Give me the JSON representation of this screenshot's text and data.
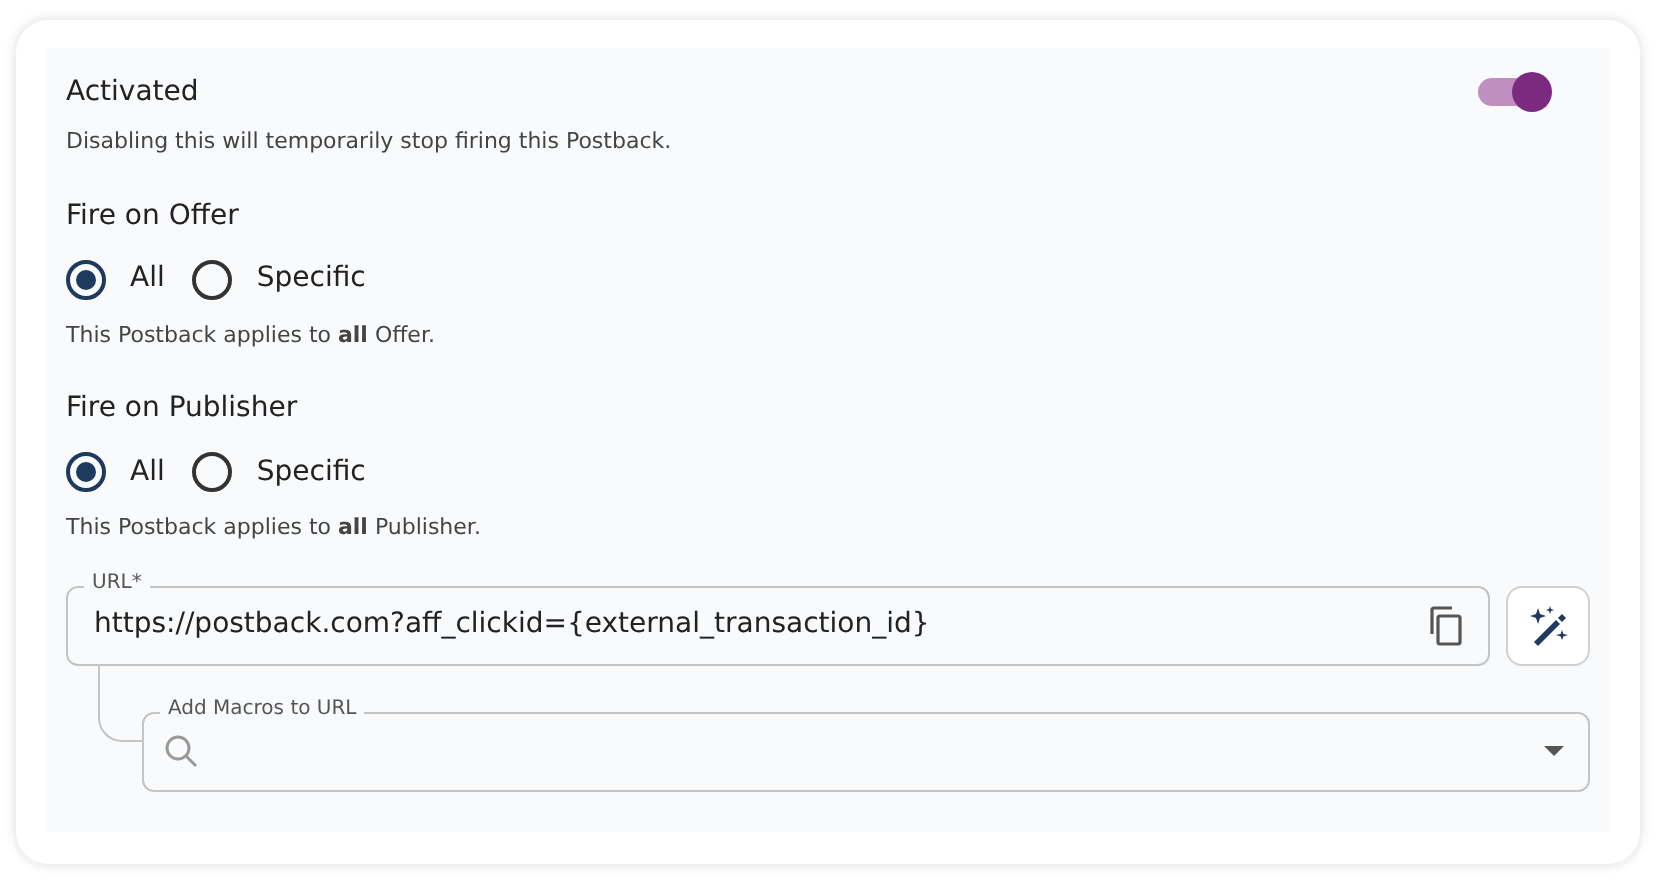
{
  "activated": {
    "label": "Activated",
    "on": true,
    "description": "Disabling this will temporarily stop firing this Postback."
  },
  "sections": [
    {
      "title": "Fire on Offer",
      "options": [
        {
          "label": "All",
          "selected": true
        },
        {
          "label": "Specific",
          "selected": false
        }
      ],
      "note": "This Postback applies to **all** Offer."
    },
    {
      "title": "Fire on Publisher",
      "options": [
        {
          "label": "All",
          "selected": true
        },
        {
          "label": "Specific",
          "selected": false
        }
      ],
      "note": "This Postback applies to **all** Publisher."
    }
  ],
  "url_field": {
    "label": "URL*",
    "value": "https://postback.com?aff_clickid={external_transaction_id}"
  },
  "macros_field": {
    "label": "Add Macros to URL"
  }
}
